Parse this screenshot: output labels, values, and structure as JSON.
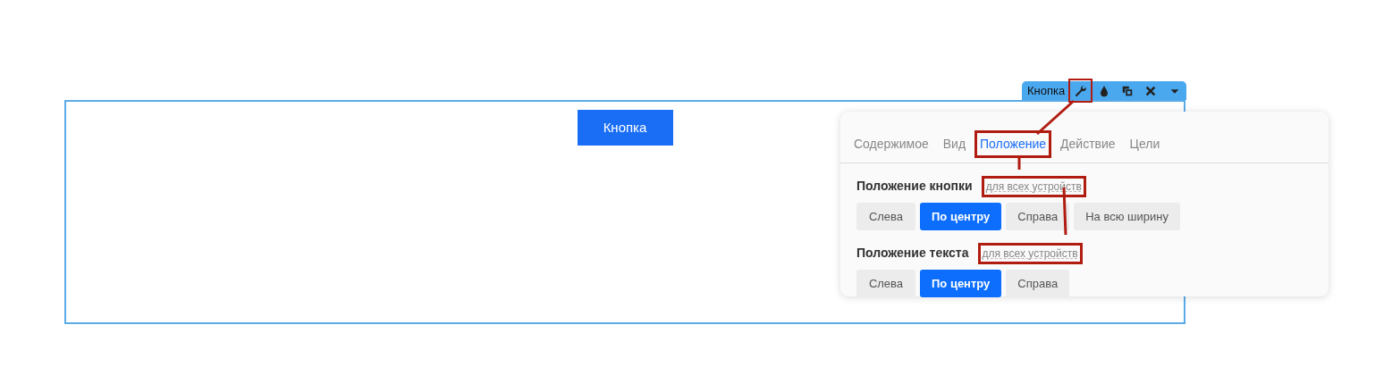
{
  "block": {
    "button_label": "Кнопка"
  },
  "toolbar": {
    "title": "Кнопка",
    "tools": [
      {
        "kind": "wrench",
        "highlighted": true
      },
      {
        "kind": "drop",
        "highlighted": false
      },
      {
        "kind": "copy",
        "highlighted": false
      },
      {
        "kind": "close",
        "highlighted": false
      },
      {
        "kind": "caret",
        "highlighted": false
      }
    ]
  },
  "panel": {
    "tabs": [
      {
        "label": "Содержимое",
        "selected": false,
        "highlighted": false
      },
      {
        "label": "Вид",
        "selected": false,
        "highlighted": false
      },
      {
        "label": "Положение",
        "selected": true,
        "highlighted": true
      },
      {
        "label": "Действие",
        "selected": false,
        "highlighted": false
      },
      {
        "label": "Цели",
        "selected": false,
        "highlighted": false
      }
    ],
    "sections": [
      {
        "title": "Положение кнопки",
        "hint": "для всех устройств",
        "highlighted": true,
        "options": [
          {
            "label": "Слева",
            "selected": false
          },
          {
            "label": "По центру",
            "selected": true
          },
          {
            "label": "Справа",
            "selected": false
          },
          {
            "label": "На всю ширину",
            "selected": false
          }
        ]
      },
      {
        "title": "Положение текста",
        "hint": "для всех устройств",
        "highlighted": true,
        "options": [
          {
            "label": "Слева",
            "selected": false
          },
          {
            "label": "По центру",
            "selected": true
          },
          {
            "label": "Справа",
            "selected": false
          }
        ]
      }
    ]
  }
}
